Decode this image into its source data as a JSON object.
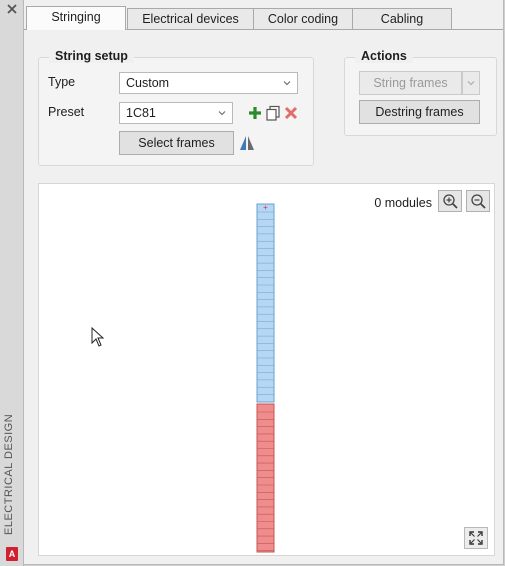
{
  "side_panel": {
    "label": "ELECTRICAL DESIGN",
    "badge": "A"
  },
  "tabs": [
    {
      "label": "Stringing",
      "active": true
    },
    {
      "label": "Electrical devices",
      "active": false
    },
    {
      "label": "Color coding",
      "active": false
    },
    {
      "label": "Cabling",
      "active": false
    }
  ],
  "string_setup": {
    "title": "String setup",
    "type_label": "Type",
    "type_value": "Custom",
    "preset_label": "Preset",
    "preset_value": "1C81",
    "select_frames_label": "Select frames"
  },
  "actions": {
    "title": "Actions",
    "string_frames_label": "String frames",
    "destring_frames_label": "Destring frames"
  },
  "preview": {
    "modules_count": "0 modules",
    "positive_marker": "+",
    "colors": {
      "string_fill": "#b5d7f3",
      "string_stroke": "#6aa1cf",
      "unstrung_fill": "#ef8d8d",
      "unstrung_stroke": "#c45454"
    }
  },
  "icons": {
    "close": "close-icon",
    "add": "plus-icon",
    "copy": "copy-icon",
    "delete": "delete-icon",
    "mirror": "mirror-icon",
    "zoom_in": "zoom-in-icon",
    "zoom_out": "zoom-out-icon",
    "fit": "fit-to-view-icon"
  }
}
